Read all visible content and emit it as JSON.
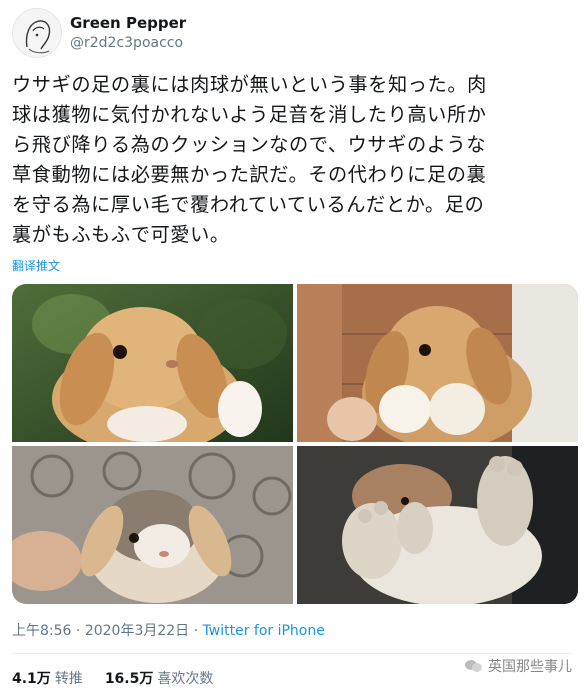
{
  "author": {
    "display_name": "Green Pepper",
    "handle": "@r2d2c3poacco"
  },
  "tweet": {
    "text": "ウサギの足の裏には肉球が無いという事を知った。肉\n球は獲物に気付かれないよう足音を消したり高い所か\nら飛び降りる為のクッションなので、ウサギのような\n草食動物には必要無かった訳だ。その代わりに足の裏\nを守る為に厚い毛で覆われていているんだとか。足の\n裏がもふもふで可愛い。",
    "translate_label": "翻译推文"
  },
  "media": [
    {
      "icon": "bunny-photo-icon",
      "subject": "lop rabbit sitting up outdoors"
    },
    {
      "icon": "bunny-photo-icon",
      "subject": "lop rabbit held showing paws"
    },
    {
      "icon": "bunny-photo-icon",
      "subject": "grey-brown bunny held in hand"
    },
    {
      "icon": "bunny-photo-icon",
      "subject": "close-up of furry rabbit feet"
    }
  ],
  "meta": {
    "time": "上午8:56",
    "separator": " · ",
    "date": "2020年3月22日",
    "source": "Twitter for iPhone"
  },
  "stats": {
    "retweets_count": "4.1万",
    "retweets_label": "转推",
    "likes_count": "16.5万",
    "likes_label": "喜欢次数"
  },
  "watermark": {
    "text": "英国那些事儿"
  },
  "colors": {
    "link": "#1b95e0",
    "muted": "#657786",
    "text": "#14171a"
  }
}
